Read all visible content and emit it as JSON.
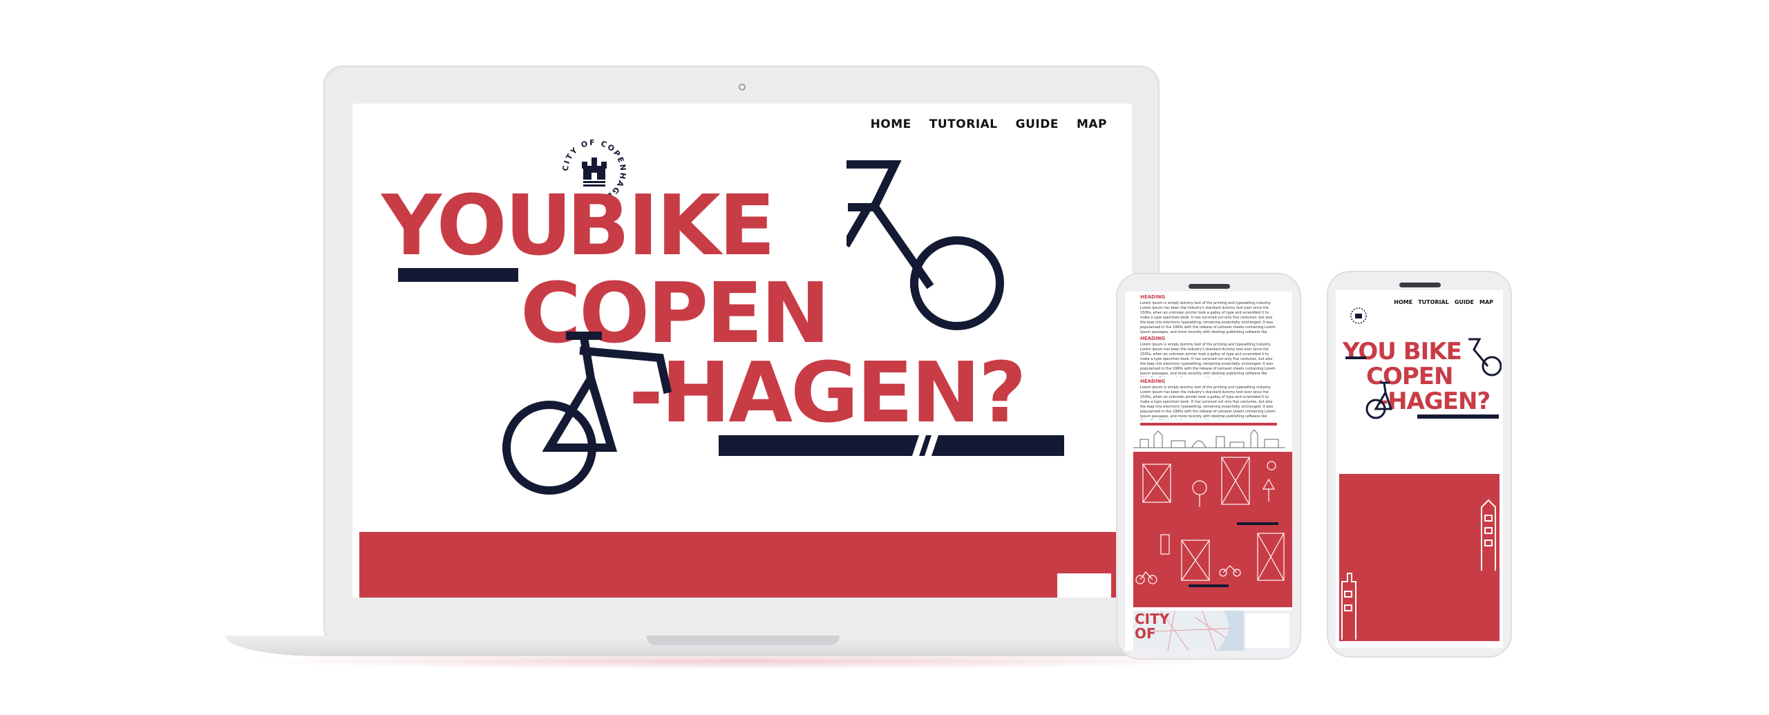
{
  "colors": {
    "brand_red": "#c83c46",
    "navy": "#141a33"
  },
  "laptop": {
    "nav": {
      "home": "HOME",
      "tutorial": "TUTORIAL",
      "guide": "GUIDE",
      "map": "MAP"
    },
    "logo_text": "CITY OF COPENHAGEN",
    "hero": {
      "line1_a": "YOU",
      "line1_b": "BIKE",
      "line2": "COPEN",
      "line3": "-HAGEN?"
    }
  },
  "phone1": {
    "sections": [
      {
        "heading": "HEADING",
        "body": "Lorem Ipsum is simply dummy text of the printing and typesetting industry. Lorem Ipsum has been the industry's standard dummy text ever since the 1500s, when an unknown printer took a galley of type and scrambled it to make a type specimen book. It has survived not only five centuries, but also the leap into electronic typesetting, remaining essentially unchanged. It was popularised in the 1960s with the release of Letraset sheets containing Lorem Ipsum passages, and more recently with desktop publishing software like Aldus PageMaker including versions of Lorem Ipsum."
      },
      {
        "heading": "HEADING",
        "body": "Lorem Ipsum is simply dummy text of the printing and typesetting industry. Lorem Ipsum has been the industry's standard dummy text ever since the 1500s, when an unknown printer took a galley of type and scrambled it to make a type specimen book. It has survived not only five centuries, but also the leap into electronic typesetting, remaining essentially unchanged. It was popularised in the 1960s with the release of Letraset sheets containing Lorem Ipsum passages, and more recently with desktop publishing software like Aldus PageMaker including versions of Lorem Ipsum."
      },
      {
        "heading": "HEADING",
        "body": "Lorem Ipsum is simply dummy text of the printing and typesetting industry. Lorem Ipsum has been the industry's standard dummy text ever since the 1500s, when an unknown printer took a galley of type and scrambled it to make a type specimen book. It has survived not only five centuries, but also the leap into electronic typesetting, remaining essentially unchanged. It was popularised in the 1960s with the release of Letraset sheets containing Lorem Ipsum passages, and more recently with desktop publishing software like Aldus PageMaker including versions of Lorem Ipsum."
      }
    ],
    "map_title_1": "CITY",
    "map_title_2": "OF"
  },
  "phone2": {
    "nav": {
      "home": "HOME",
      "tutorial": "TUTORIAL",
      "guide": "GUIDE",
      "map": "MAP"
    },
    "hero": {
      "line1": "YOU BIKE",
      "line2": "COPEN",
      "line3": "-HAGEN?"
    }
  }
}
